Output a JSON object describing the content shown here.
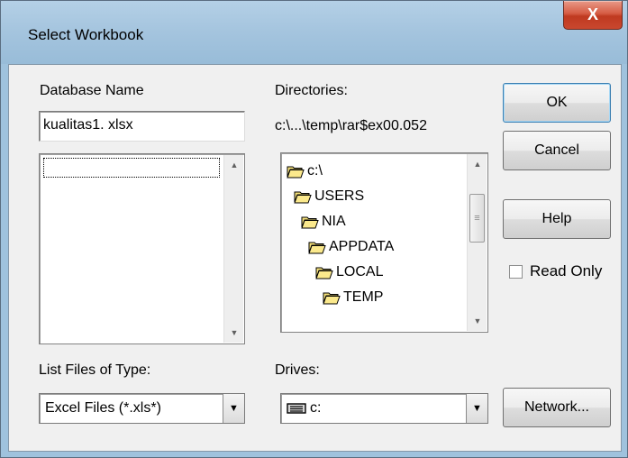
{
  "window": {
    "title": "Select Workbook",
    "close_label": "X"
  },
  "database_name": {
    "label": "Database Name",
    "value": "kualitas1. xlsx"
  },
  "directories": {
    "label": "Directories:",
    "path": "c:\\...\\temp\\rar$ex00.052",
    "items": [
      "c:\\",
      "USERS",
      "NIA",
      "APPDATA",
      "LOCAL",
      "TEMP"
    ]
  },
  "buttons": {
    "ok": "OK",
    "cancel": "Cancel",
    "help": "Help",
    "network": "Network..."
  },
  "read_only": {
    "label": "Read Only",
    "checked": false
  },
  "file_type": {
    "label": "List Files of Type:",
    "value": "Excel Files (*.xls*)"
  },
  "drives": {
    "label": "Drives:",
    "value": "c:"
  },
  "icons": {
    "folder": "folder-open-icon",
    "drive": "drive-icon",
    "dropdown": "chevron-down-icon"
  },
  "colors": {
    "title_bar": "#a4c4de",
    "close_button": "#c9472e",
    "dialog_bg": "#f0f0f0",
    "default_button_border": "#3c7fb1"
  }
}
